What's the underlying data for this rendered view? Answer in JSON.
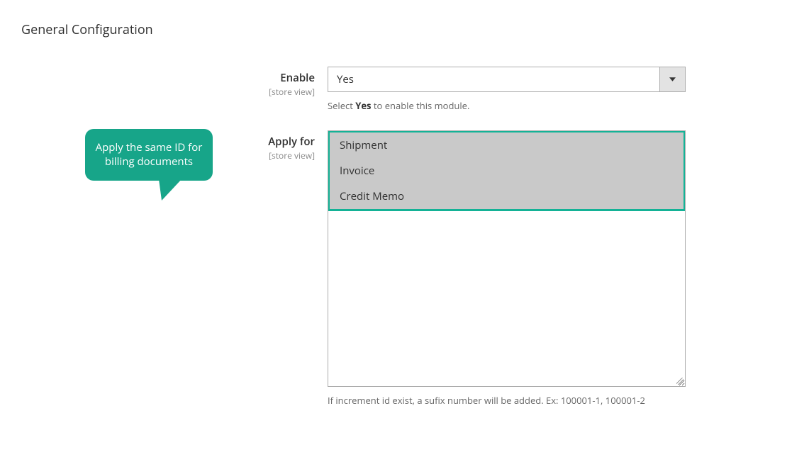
{
  "section": {
    "title": "General Configuration"
  },
  "annotations": {
    "bubble_text": "Apply the same ID for billing documents"
  },
  "fields": {
    "enable": {
      "label": "Enable",
      "scope": "[store view]",
      "value": "Yes",
      "help_prefix": "Select ",
      "help_bold": "Yes",
      "help_suffix": " to enable this module."
    },
    "apply_for": {
      "label": "Apply for",
      "scope": "[store view]",
      "options": [
        {
          "label": "Shipment",
          "selected": true
        },
        {
          "label": "Invoice",
          "selected": true
        },
        {
          "label": "Credit Memo",
          "selected": true
        }
      ],
      "help": "If increment id exist, a sufix number will be added. Ex: 100001-1, 100001-2"
    }
  }
}
